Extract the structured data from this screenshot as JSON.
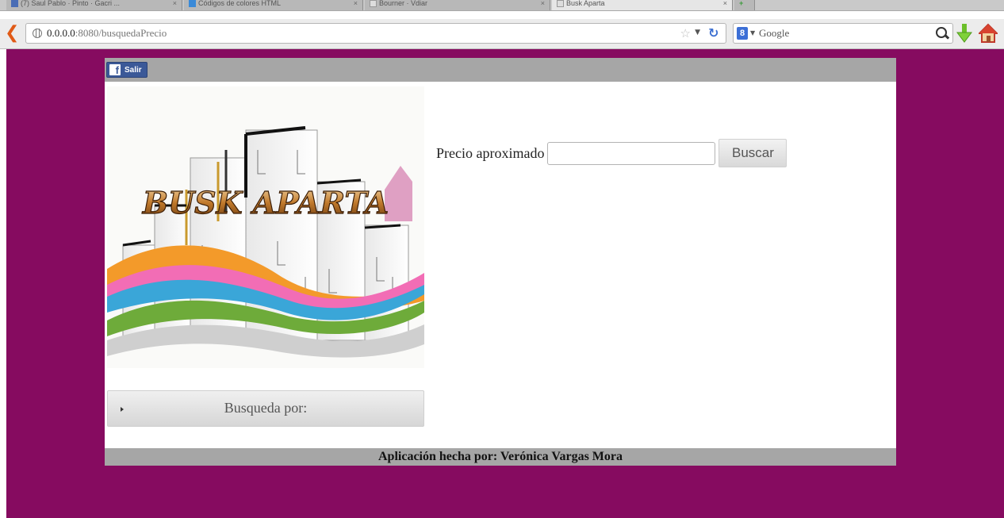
{
  "browser": {
    "tabs": [
      {
        "label": "(7) Saul Pablo · Pinto · Gacri ..."
      },
      {
        "label": "Códigos de colores HTML"
      },
      {
        "label": "Bourner · Vdiar"
      },
      {
        "label": "Busk Aparta"
      }
    ],
    "url_host": "0.0.0.0",
    "url_rest": ":8080/busquedaPrecio",
    "search_engine": "Google",
    "google_badge": "8",
    "icons": [
      "back-icon",
      "globe-icon",
      "star-icon",
      "reload-icon",
      "google-icon",
      "magnify-icon",
      "download-icon",
      "home-icon"
    ]
  },
  "page": {
    "background": "#860b60",
    "frame_bar_color": "#a6a6a6",
    "fb_button": {
      "label": "Salir",
      "icon_glyph": "f"
    },
    "logo_text": "BUSK APARTA",
    "search": {
      "label": "Precio aproximado",
      "input_value": "",
      "button_label": "Buscar"
    },
    "accordion": {
      "label": "Busqueda por:"
    },
    "footer": "Aplicación hecha por: Verónica Vargas Mora"
  }
}
